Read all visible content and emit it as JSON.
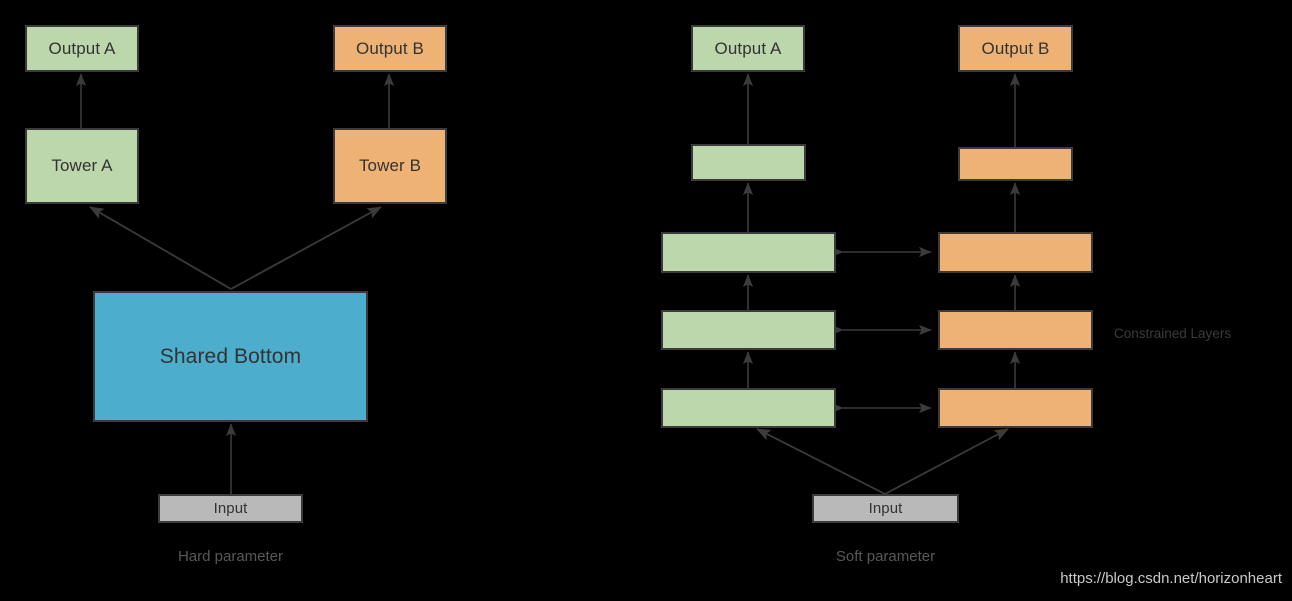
{
  "diagram": {
    "title_hidden": "",
    "background_color": "#000000",
    "palette": {
      "green": "#bdd7ad",
      "orange": "#efb275",
      "blue": "#4cadcd",
      "gray": "#b9b9b9",
      "stroke": "#3b3b3b",
      "caption_text": "#585858",
      "watermark_text": "#c9c9c9"
    },
    "left_panel": {
      "caption": "Hard parameter",
      "nodes": {
        "output_a": "Output A",
        "output_b": "Output B",
        "tower_a": "Tower A",
        "tower_b": "Tower B",
        "shared_bottom": "Shared Bottom",
        "input": "Input"
      }
    },
    "right_panel": {
      "caption": "Soft parameter",
      "side_note": "Constrained Layers",
      "nodes": {
        "output_a": "Output A",
        "output_b": "Output B",
        "input": "Input",
        "green_layer_top": "",
        "green_layer_3": "",
        "green_layer_2": "",
        "green_layer_1": "",
        "orange_layer_top": "",
        "orange_layer_3": "",
        "orange_layer_2": "",
        "orange_layer_1": ""
      }
    },
    "watermark": "https://blog.csdn.net/horizonheart"
  }
}
